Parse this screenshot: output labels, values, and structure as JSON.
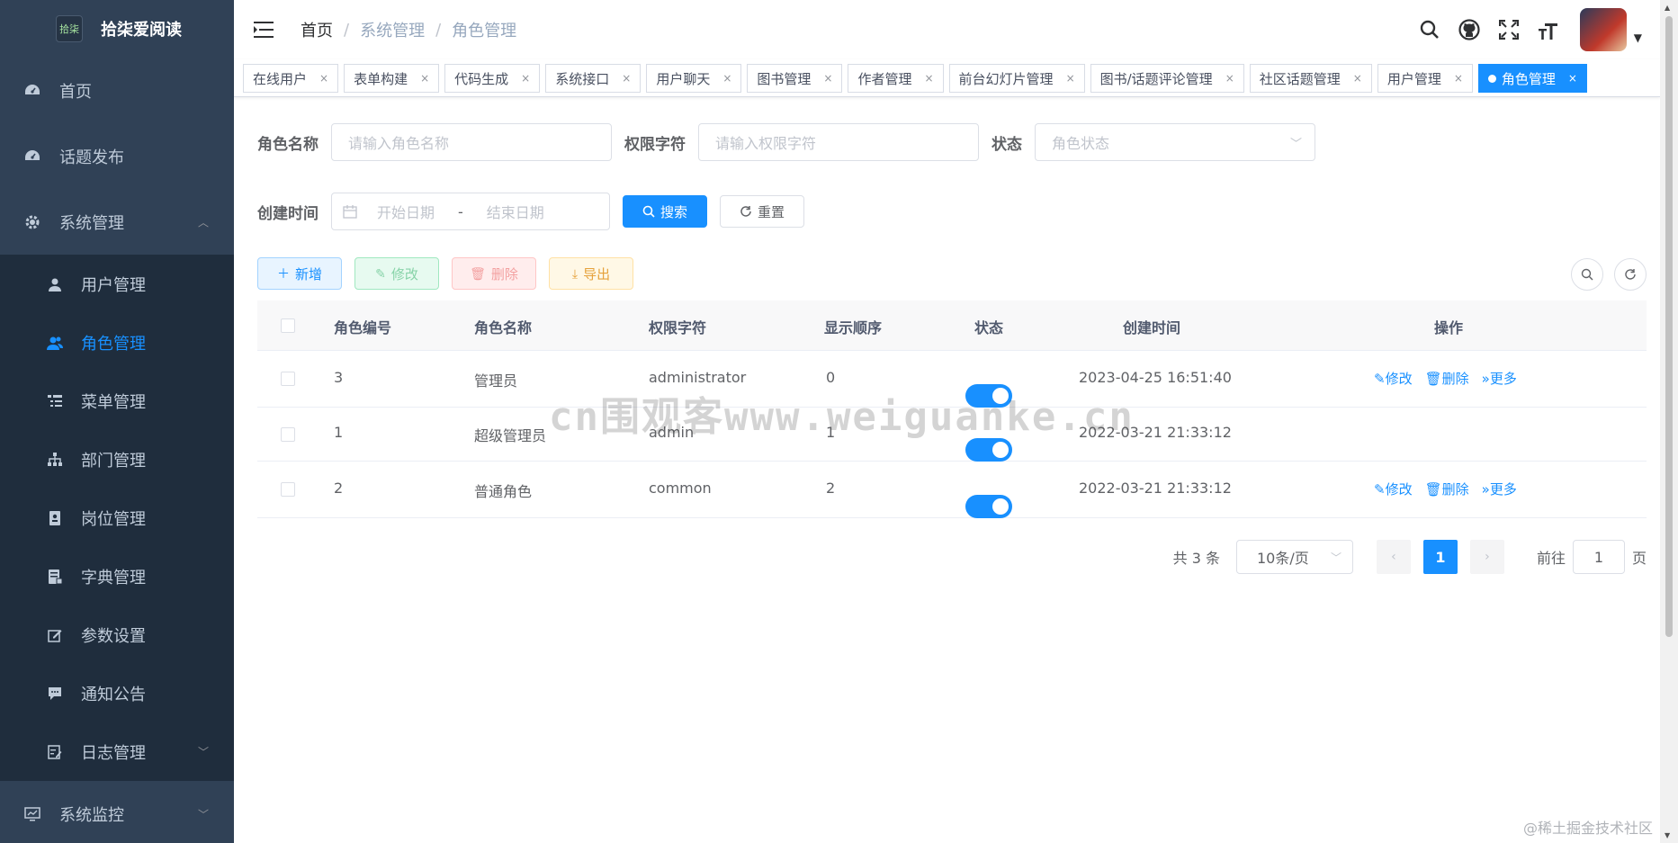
{
  "app": {
    "title": "拾柒爱阅读",
    "logo_text": "拾柒"
  },
  "sidebar": {
    "items": [
      {
        "label": "首页",
        "icon": "dashboard-icon"
      },
      {
        "label": "话题发布",
        "icon": "dashboard-icon"
      },
      {
        "label": "系统管理",
        "icon": "gear-icon",
        "expanded": true
      },
      {
        "label": "系统监控",
        "icon": "monitor-icon"
      }
    ],
    "system_submenu": [
      {
        "label": "用户管理",
        "icon": "user-icon"
      },
      {
        "label": "角色管理",
        "icon": "peoples-icon",
        "active": true
      },
      {
        "label": "菜单管理",
        "icon": "tree-table-icon"
      },
      {
        "label": "部门管理",
        "icon": "tree-icon"
      },
      {
        "label": "岗位管理",
        "icon": "post-icon"
      },
      {
        "label": "字典管理",
        "icon": "dict-icon"
      },
      {
        "label": "参数设置",
        "icon": "edit-icon"
      },
      {
        "label": "通知公告",
        "icon": "message-icon"
      },
      {
        "label": "日志管理",
        "icon": "log-icon"
      }
    ]
  },
  "navbar": {
    "breadcrumb": [
      "首页",
      "系统管理",
      "角色管理"
    ]
  },
  "tags": [
    {
      "label": "在线用户"
    },
    {
      "label": "表单构建"
    },
    {
      "label": "代码生成"
    },
    {
      "label": "系统接口"
    },
    {
      "label": "用户聊天"
    },
    {
      "label": "图书管理"
    },
    {
      "label": "作者管理"
    },
    {
      "label": "前台幻灯片管理"
    },
    {
      "label": "图书/话题评论管理"
    },
    {
      "label": "社区话题管理"
    },
    {
      "label": "用户管理"
    },
    {
      "label": "角色管理",
      "active": true
    }
  ],
  "search": {
    "role_name_label": "角色名称",
    "role_name_placeholder": "请输入角色名称",
    "role_key_label": "权限字符",
    "role_key_placeholder": "请输入权限字符",
    "status_label": "状态",
    "status_placeholder": "角色状态",
    "created_label": "创建时间",
    "start_placeholder": "开始日期",
    "range_sep": "-",
    "end_placeholder": "结束日期",
    "search_btn": "搜索",
    "reset_btn": "重置"
  },
  "toolbar": {
    "add": "新增",
    "edit": "修改",
    "delete": "删除",
    "export": "导出"
  },
  "table": {
    "columns": [
      "角色编号",
      "角色名称",
      "权限字符",
      "显示顺序",
      "状态",
      "创建时间",
      "操作"
    ],
    "rows": [
      {
        "id": "3",
        "name": "管理员",
        "key": "administrator",
        "sort": "0",
        "status": true,
        "created": "2023-04-25 16:51:40",
        "ops": true
      },
      {
        "id": "1",
        "name": "超级管理员",
        "key": "admin",
        "sort": "1",
        "status": true,
        "created": "2022-03-21 21:33:12",
        "ops": false
      },
      {
        "id": "2",
        "name": "普通角色",
        "key": "common",
        "sort": "2",
        "status": true,
        "created": "2022-03-21 21:33:12",
        "ops": true
      }
    ],
    "op_edit": "修改",
    "op_delete": "删除",
    "op_more": "更多"
  },
  "pagination": {
    "total": "共 3 条",
    "page_size": "10条/页",
    "current": "1",
    "goto_label": "前往",
    "goto_value": "1",
    "page_suffix": "页"
  },
  "watermark": "cn围观客www.weiguanke.cn",
  "corner_mark": "@稀土掘金技术社区",
  "colors": {
    "sidebar_bg": "#304156",
    "primary": "#1890ff"
  }
}
